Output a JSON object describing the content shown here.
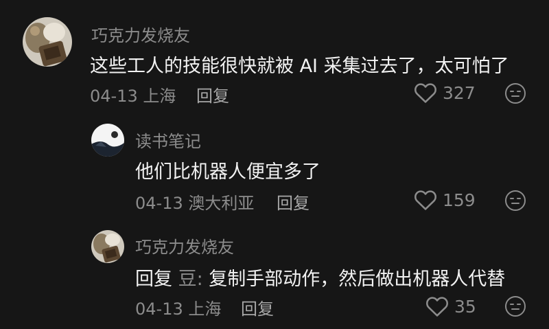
{
  "comments": [
    {
      "username": "巧克力发烧友",
      "text": "这些工人的技能很快就被 AI 采集过去了，太可怕了",
      "date": "04-13",
      "location": "上海",
      "reply_label": "回复",
      "likes": "327"
    },
    {
      "username": "读书笔记",
      "text": "他们比机器人便宜多了",
      "date": "04-13",
      "location": "澳大利亚",
      "reply_label": "回复",
      "likes": "159"
    },
    {
      "username": "巧克力发烧友",
      "reply_prefix": "回复",
      "reply_to": "豆:",
      "text": "复制手部动作，然后做出机器人代替",
      "date": "04-13",
      "location": "上海",
      "reply_label": "回复",
      "likes": "35"
    }
  ],
  "icons": {
    "like": "heart-outline-icon",
    "reaction": "neutral-face-icon"
  },
  "colors": {
    "background": "#161616",
    "text": "#f2f2f2",
    "muted": "#8c8c8c"
  }
}
